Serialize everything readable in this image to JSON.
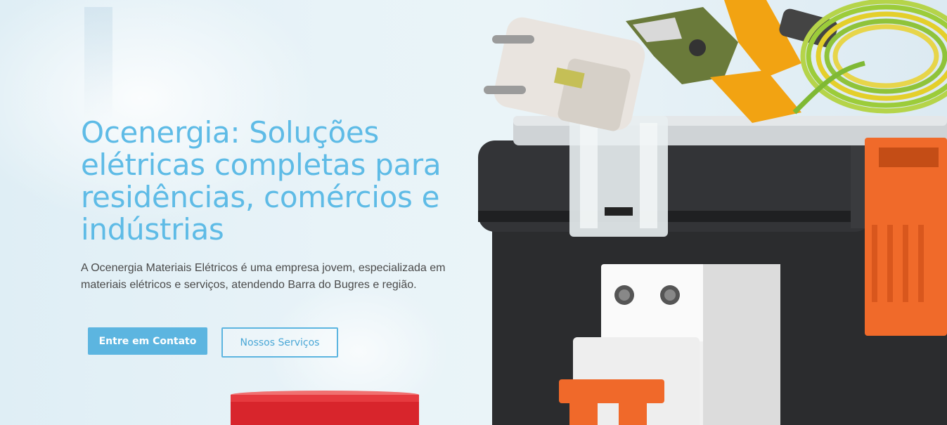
{
  "hero": {
    "title": "Ocenergia: Soluções elétricas completas para residências, comércios e indústrias",
    "description": "A Ocenergia Materiais Elétricos é uma empresa jovem, especializada em materiais elétricos e serviços, atendendo Barra do Bugres e região.",
    "primary_button": "Entre em Contato",
    "secondary_button": "Nossos Serviços"
  },
  "colors": {
    "accent": "#5ebbe6",
    "button_primary_bg": "#5cb5e0",
    "body_text": "#4a4a4a"
  },
  "image": {
    "subject": "electrical-tools-toolbox"
  }
}
